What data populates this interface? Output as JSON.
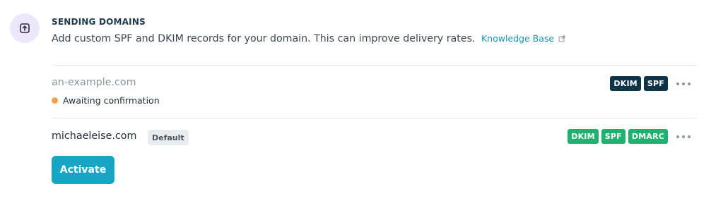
{
  "header": {
    "icon": "upload-document-icon",
    "title": "SENDING DOMAINS",
    "description": "Add custom SPF and DKIM records for your domain. This can improve delivery rates.",
    "link_label": "Knowledge Base",
    "link_icon": "external-link-icon"
  },
  "domains": [
    {
      "name": "an-example.com",
      "status": "Awaiting confirmation",
      "status_color": "#f4a04a",
      "badges": [
        "DKIM",
        "SPF"
      ],
      "badge_color": "#0e3547",
      "menu_icon": "more-horizontal-icon"
    },
    {
      "name": "michaeleise.com",
      "tag": "Default",
      "badges": [
        "DKIM",
        "SPF",
        "DMARC"
      ],
      "badge_color": "#1fb16e",
      "menu_icon": "more-horizontal-icon"
    }
  ],
  "actions": {
    "activate_label": "Activate",
    "activate_color": "#16a5c4"
  }
}
